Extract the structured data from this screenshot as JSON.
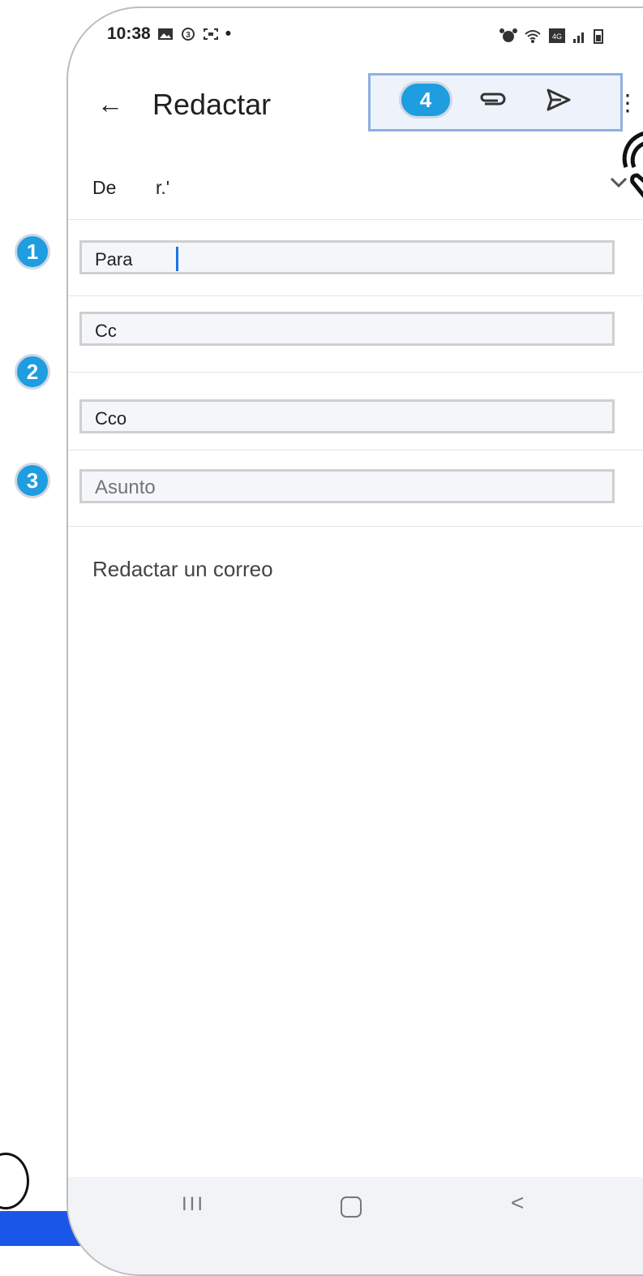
{
  "status_bar": {
    "time": "10:38",
    "dot": "•"
  },
  "app_bar": {
    "back_icon": "arrow-left-icon",
    "title": "Redactar",
    "attach_icon": "paperclip-icon",
    "send_icon": "send-icon",
    "more_icon": "more-vert-icon"
  },
  "from": {
    "label": "De",
    "value": "r.'"
  },
  "fields": {
    "to_label": "Para",
    "cc_label": "Cc",
    "bcc_label": "Cco",
    "subject_placeholder": "Asunto"
  },
  "body": {
    "placeholder": "Redactar un correo"
  },
  "badges": {
    "b1": "1",
    "b2": "2",
    "b3": "3",
    "b4": "4"
  },
  "nav": {
    "recent": "III",
    "back": "<"
  },
  "colors": {
    "accent": "#1a73e8",
    "badge": "#1e9de0",
    "band": "#1a56e8"
  }
}
